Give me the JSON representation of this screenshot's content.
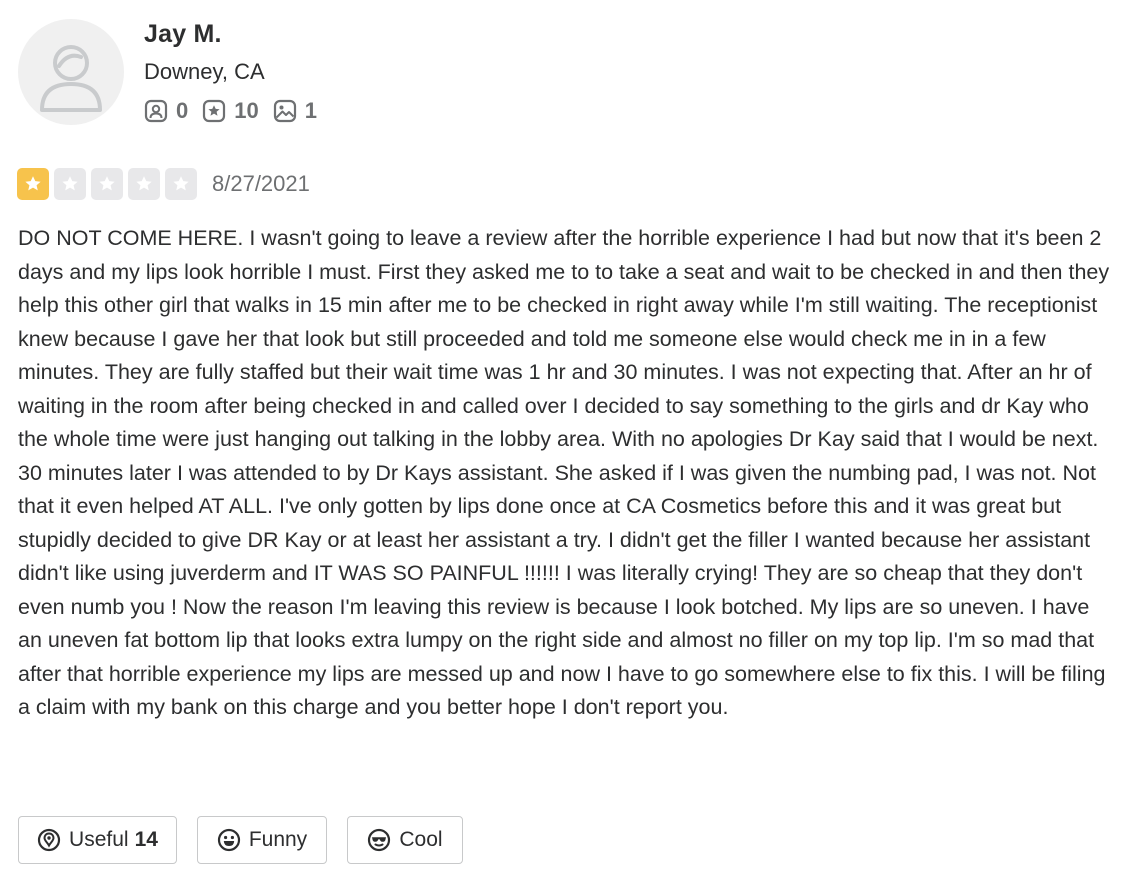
{
  "user": {
    "name": "Jay M.",
    "location": "Downey, CA",
    "stats": {
      "friends": "0",
      "reviews": "10",
      "photos": "1"
    }
  },
  "review": {
    "rating": 1,
    "max_rating": 5,
    "date": "8/27/2021",
    "text": "DO NOT COME HERE. I wasn't going to leave a review after the horrible experience I had but now that it's been 2 days and my lips look horrible I must. First they asked me to to take a seat and wait to be checked in and then they help this other girl that walks in 15 min after me to be checked in right away while I'm still waiting. The receptionist knew because I gave her that look but still proceeded and told me someone else would check me in in a few minutes. They are fully staffed but their wait time was 1 hr and 30 minutes. I was not expecting that. After an hr of waiting in the room after being checked in and called over I decided to say something to the girls and dr Kay who the whole time were just hanging out talking in the lobby area. With no apologies Dr Kay said that I would be next. 30 minutes later I was attended to by Dr Kays assistant. She asked if I was given the numbing pad, I was not. Not that it even helped AT ALL. I've only gotten by lips done once at CA Cosmetics before this and it was great but stupidly decided to give DR Kay or at least her assistant a try. I didn't get the filler I wanted because her assistant didn't like using juverderm and IT WAS SO PAINFUL !!!!!!  I was literally crying! They are so cheap that they don't even numb you ! Now the reason I'm leaving this review is because I look botched. My lips are so uneven. I have an uneven fat bottom lip that looks extra lumpy on the right side and almost no filler on my top lip. I'm so mad that after that horrible experience my lips are messed up and now I have to go somewhere else to fix this. I will be filing a claim with my bank on this charge and you better hope I don't report you."
  },
  "reactions": {
    "useful_label": "Useful",
    "useful_count": "14",
    "funny_label": "Funny",
    "cool_label": "Cool"
  },
  "icons": {
    "avatar": "default-user-avatar-icon",
    "friends": "friends-icon",
    "reviews": "review-star-icon",
    "photos": "photo-icon",
    "useful": "lightbulb-icon",
    "funny": "smiley-icon",
    "cool": "sunglasses-icon"
  },
  "colors": {
    "star_filled": "#f7c34c",
    "star_empty": "#e8e8ea",
    "text": "#2d2e2f",
    "muted": "#6e7072"
  }
}
